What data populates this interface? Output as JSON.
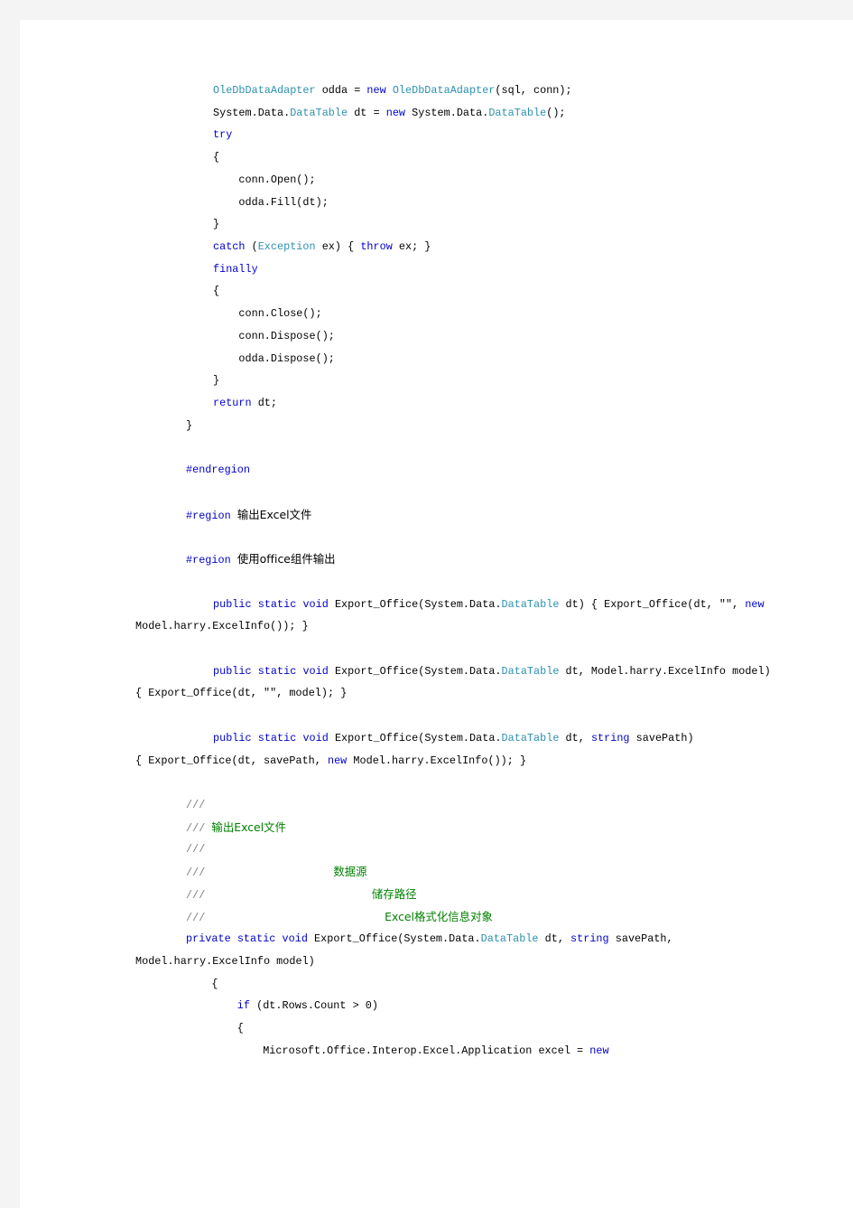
{
  "document": {
    "language": "C#",
    "page_background": "#ffffff",
    "gutter_color": "#f4f4f4",
    "syntax_colors": {
      "keyword": "#0000cc",
      "type": "#2b91af",
      "comment": "#008000",
      "comment_slash": "#808080",
      "preprocessor": "#0000cc",
      "default": "#000000"
    }
  },
  "code_lines": [
    {
      "indent": "code",
      "tokens": [
        {
          "t": "OleDbDataAdapter",
          "c": "type"
        },
        {
          "t": " odda = ",
          "c": "plain"
        },
        {
          "t": "new",
          "c": "kw"
        },
        {
          "t": " ",
          "c": "plain"
        },
        {
          "t": "OleDbDataAdapter",
          "c": "type"
        },
        {
          "t": "(sql, conn);",
          "c": "plain"
        }
      ]
    },
    {
      "indent": "code",
      "tokens": [
        {
          "t": "System.Data.",
          "c": "plain"
        },
        {
          "t": "DataTable",
          "c": "type"
        },
        {
          "t": " dt = ",
          "c": "plain"
        },
        {
          "t": "new",
          "c": "kw"
        },
        {
          "t": " System.Data.",
          "c": "plain"
        },
        {
          "t": "DataTable",
          "c": "type"
        },
        {
          "t": "();",
          "c": "plain"
        }
      ]
    },
    {
      "indent": "code",
      "tokens": [
        {
          "t": "try",
          "c": "kw"
        }
      ]
    },
    {
      "indent": "code",
      "tokens": [
        {
          "t": "{",
          "c": "plain"
        }
      ]
    },
    {
      "indent": "code",
      "tokens": [
        {
          "t": "    conn.Open();",
          "c": "plain"
        }
      ]
    },
    {
      "indent": "code",
      "tokens": [
        {
          "t": "    odda.Fill(dt);",
          "c": "plain"
        }
      ]
    },
    {
      "indent": "code",
      "tokens": [
        {
          "t": "}",
          "c": "plain"
        }
      ]
    },
    {
      "indent": "code",
      "tokens": [
        {
          "t": "catch",
          "c": "kw"
        },
        {
          "t": " (",
          "c": "plain"
        },
        {
          "t": "Exception",
          "c": "type"
        },
        {
          "t": " ex) { ",
          "c": "plain"
        },
        {
          "t": "throw",
          "c": "kw"
        },
        {
          "t": " ex; }",
          "c": "plain"
        }
      ]
    },
    {
      "indent": "code",
      "tokens": [
        {
          "t": "finally",
          "c": "kw"
        }
      ]
    },
    {
      "indent": "code",
      "tokens": [
        {
          "t": "{",
          "c": "plain"
        }
      ]
    },
    {
      "indent": "code",
      "tokens": [
        {
          "t": "    conn.Close();",
          "c": "plain"
        }
      ]
    },
    {
      "indent": "code",
      "tokens": [
        {
          "t": "    conn.Dispose();",
          "c": "plain"
        }
      ]
    },
    {
      "indent": "code",
      "tokens": [
        {
          "t": "    odda.Dispose();",
          "c": "plain"
        }
      ]
    },
    {
      "indent": "code",
      "tokens": [
        {
          "t": "}",
          "c": "plain"
        }
      ]
    },
    {
      "indent": "code",
      "tokens": [
        {
          "t": "return",
          "c": "kw"
        },
        {
          "t": " dt;",
          "c": "plain"
        }
      ]
    },
    {
      "indent": "doc",
      "tokens": [
        {
          "t": "}",
          "c": "plain"
        }
      ]
    },
    {
      "blank": true
    },
    {
      "indent": "doc",
      "tokens": [
        {
          "t": "#endregion",
          "c": "pre"
        }
      ]
    },
    {
      "blank": true
    },
    {
      "indent": "doc",
      "tokens": [
        {
          "t": "#region",
          "c": "pre"
        },
        {
          "t": " ",
          "c": "plain"
        },
        {
          "t": "输出Excel文件",
          "c": "plain",
          "cjk": true
        }
      ]
    },
    {
      "blank": true
    },
    {
      "indent": "doc",
      "tokens": [
        {
          "t": "#region",
          "c": "pre"
        },
        {
          "t": " ",
          "c": "plain"
        },
        {
          "t": "使用office组件输出",
          "c": "plain",
          "cjk": true
        }
      ]
    },
    {
      "blank": true
    },
    {
      "indent": "code",
      "tokens": [
        {
          "t": "public",
          "c": "kw"
        },
        {
          "t": " ",
          "c": "plain"
        },
        {
          "t": "static",
          "c": "kw"
        },
        {
          "t": " ",
          "c": "plain"
        },
        {
          "t": "void",
          "c": "kw"
        },
        {
          "t": " Export_Office(System.Data.",
          "c": "plain"
        },
        {
          "t": "DataTable",
          "c": "type"
        },
        {
          "t": " dt) { Export_Office(dt, ",
          "c": "plain"
        },
        {
          "t": "\"\"",
          "c": "str"
        },
        {
          "t": ", ",
          "c": "plain"
        },
        {
          "t": "new",
          "c": "kw"
        }
      ]
    },
    {
      "indent": "wrap",
      "tokens": [
        {
          "t": "Model.harry.ExcelInfo()); }",
          "c": "plain"
        }
      ]
    },
    {
      "blank": true
    },
    {
      "indent": "code",
      "tokens": [
        {
          "t": "public",
          "c": "kw"
        },
        {
          "t": " ",
          "c": "plain"
        },
        {
          "t": "static",
          "c": "kw"
        },
        {
          "t": " ",
          "c": "plain"
        },
        {
          "t": "void",
          "c": "kw"
        },
        {
          "t": " Export_Office(System.Data.",
          "c": "plain"
        },
        {
          "t": "DataTable",
          "c": "type"
        },
        {
          "t": " dt, Model.harry.ExcelInfo model)",
          "c": "plain"
        }
      ]
    },
    {
      "indent": "wrap",
      "tokens": [
        {
          "t": "{ Export_Office(dt, ",
          "c": "plain"
        },
        {
          "t": "\"\"",
          "c": "str"
        },
        {
          "t": ", model); }",
          "c": "plain"
        }
      ]
    },
    {
      "blank": true
    },
    {
      "indent": "code",
      "tokens": [
        {
          "t": "public",
          "c": "kw"
        },
        {
          "t": " ",
          "c": "plain"
        },
        {
          "t": "static",
          "c": "kw"
        },
        {
          "t": " ",
          "c": "plain"
        },
        {
          "t": "void",
          "c": "kw"
        },
        {
          "t": " Export_Office(System.Data.",
          "c": "plain"
        },
        {
          "t": "DataTable",
          "c": "type"
        },
        {
          "t": " dt, ",
          "c": "plain"
        },
        {
          "t": "string",
          "c": "kw"
        },
        {
          "t": " savePath)",
          "c": "plain"
        }
      ]
    },
    {
      "indent": "wrap",
      "tokens": [
        {
          "t": "{ Export_Office(dt, savePath, ",
          "c": "plain"
        },
        {
          "t": "new",
          "c": "kw"
        },
        {
          "t": " Model.harry.ExcelInfo()); }",
          "c": "plain"
        }
      ]
    },
    {
      "blank": true
    },
    {
      "indent": "doc",
      "tokens": [
        {
          "t": "///",
          "c": "slash"
        }
      ]
    },
    {
      "indent": "doc",
      "tokens": [
        {
          "t": "///",
          "c": "slash"
        },
        {
          "t": " ",
          "c": "plain"
        },
        {
          "t": "输出Excel文件",
          "c": "cmt",
          "cjk": true
        }
      ]
    },
    {
      "indent": "doc",
      "tokens": [
        {
          "t": "///",
          "c": "slash"
        }
      ]
    },
    {
      "indent": "doc",
      "tokens": [
        {
          "t": "///",
          "c": "slash"
        },
        {
          "t": "                    ",
          "c": "plain"
        },
        {
          "t": "数据源",
          "c": "cmt",
          "cjk": true
        }
      ]
    },
    {
      "indent": "doc",
      "tokens": [
        {
          "t": "///",
          "c": "slash"
        },
        {
          "t": "                          ",
          "c": "plain"
        },
        {
          "t": "储存路径",
          "c": "cmt",
          "cjk": true
        }
      ]
    },
    {
      "indent": "doc",
      "tokens": [
        {
          "t": "///",
          "c": "slash"
        },
        {
          "t": "                            ",
          "c": "plain"
        },
        {
          "t": "Excel格式化信息对象",
          "c": "cmt",
          "cjk": true
        }
      ]
    },
    {
      "indent": "doc",
      "tokens": [
        {
          "t": "private",
          "c": "kw"
        },
        {
          "t": " ",
          "c": "plain"
        },
        {
          "t": "static",
          "c": "kw"
        },
        {
          "t": " ",
          "c": "plain"
        },
        {
          "t": "void",
          "c": "kw"
        },
        {
          "t": " Export_Office(System.Data.",
          "c": "plain"
        },
        {
          "t": "DataTable",
          "c": "type"
        },
        {
          "t": " dt, ",
          "c": "plain"
        },
        {
          "t": "string",
          "c": "kw"
        },
        {
          "t": " savePath,",
          "c": "plain"
        }
      ]
    },
    {
      "indent": "wrap",
      "tokens": [
        {
          "t": "Model.harry.ExcelInfo model)",
          "c": "plain"
        }
      ]
    },
    {
      "indent": "doc",
      "tokens": [
        {
          "t": "    {",
          "c": "plain"
        }
      ]
    },
    {
      "indent": "doc",
      "tokens": [
        {
          "t": "        ",
          "c": "plain"
        },
        {
          "t": "if",
          "c": "kw"
        },
        {
          "t": " (dt.Rows.Count > 0)",
          "c": "plain"
        }
      ]
    },
    {
      "indent": "doc",
      "tokens": [
        {
          "t": "        {",
          "c": "plain"
        }
      ]
    },
    {
      "indent": "doc",
      "tokens": [
        {
          "t": "            Microsoft.Office.Interop.Excel.Application excel = ",
          "c": "plain"
        },
        {
          "t": "new",
          "c": "kw"
        }
      ]
    }
  ]
}
